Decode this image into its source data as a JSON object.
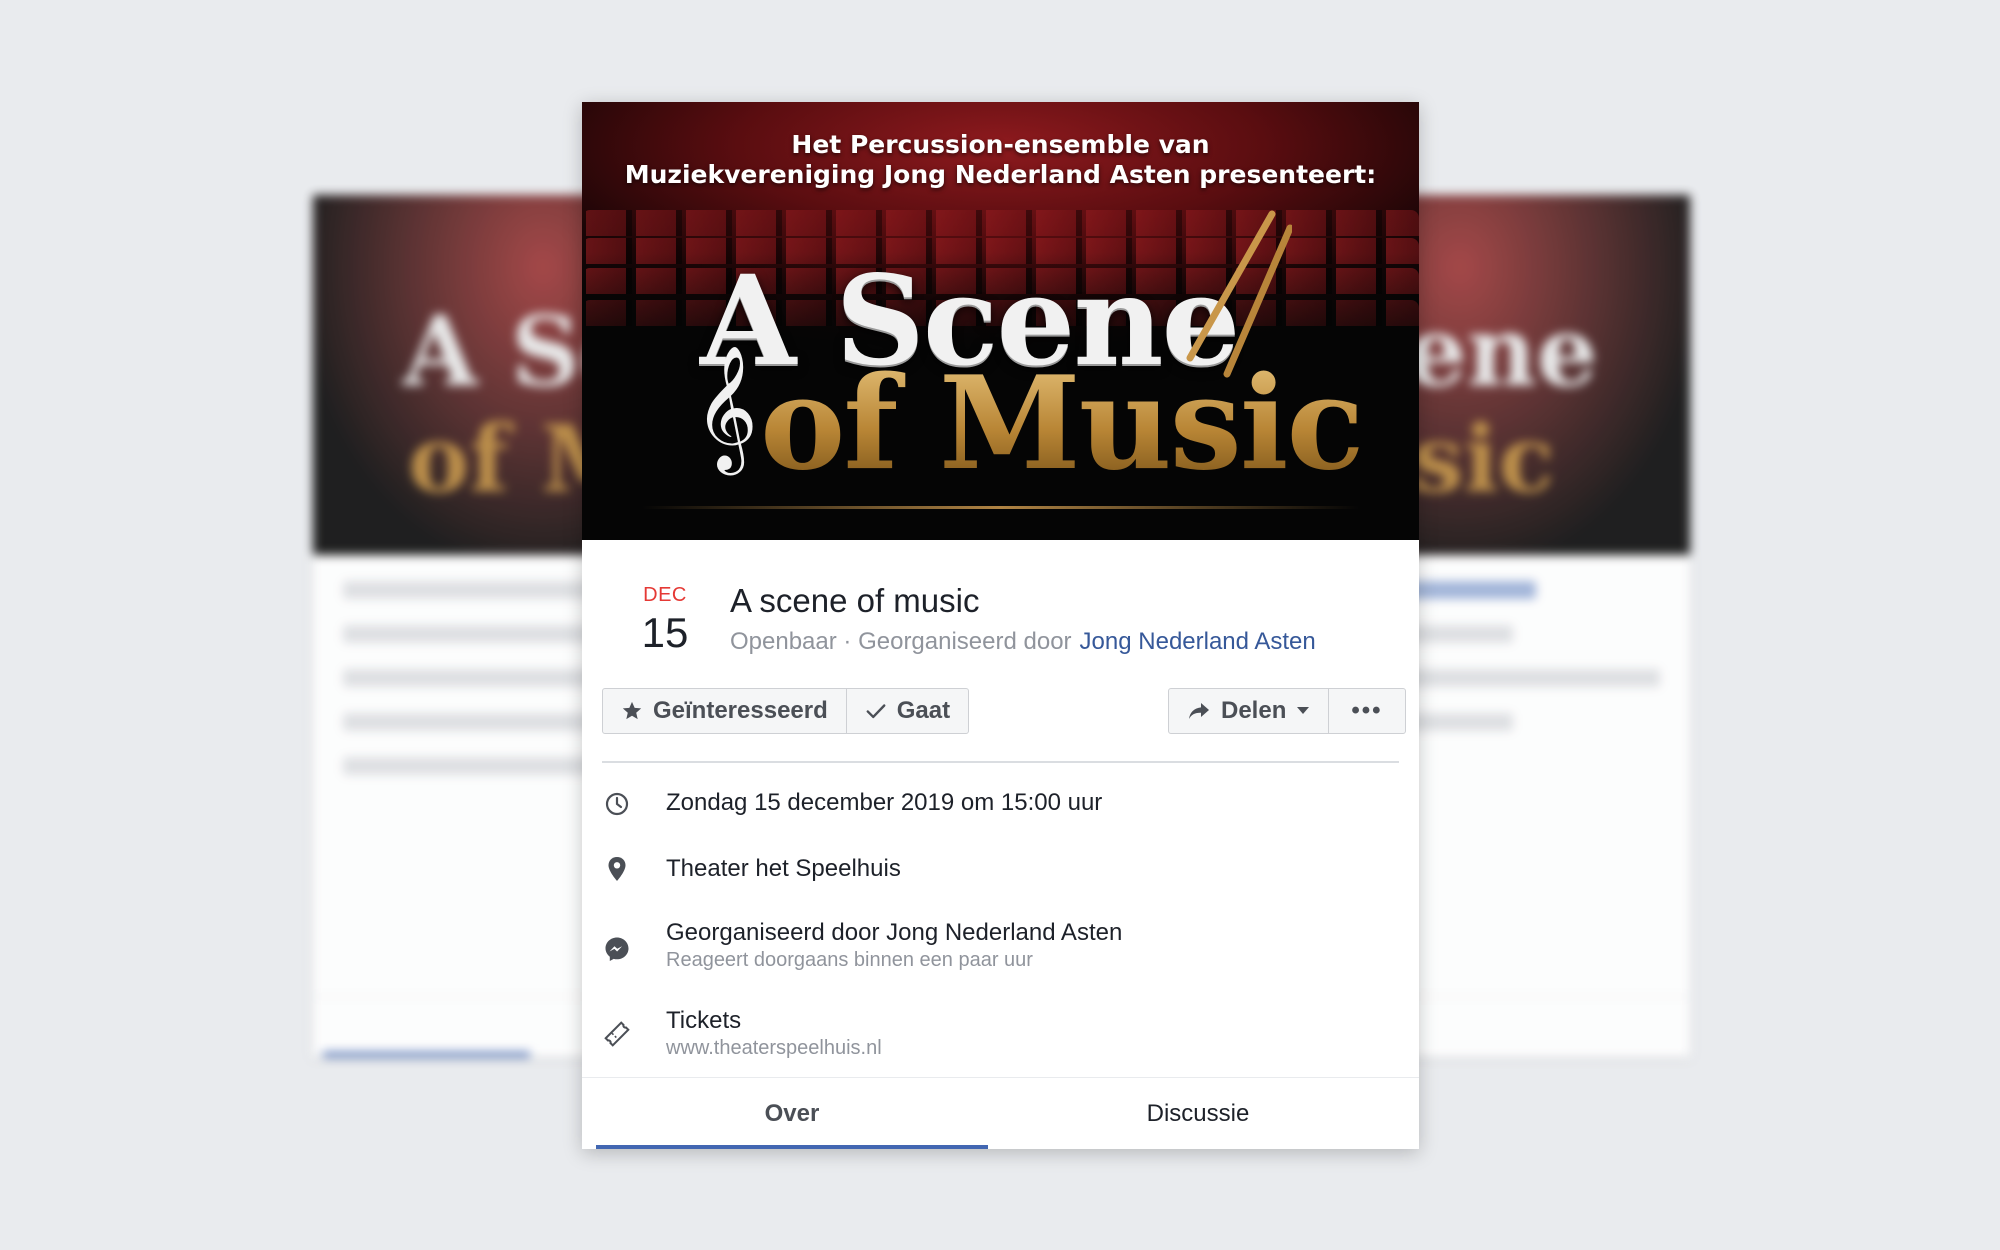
{
  "banner": {
    "subtitle_line1": "Het Percussion-ensemble van",
    "subtitle_line2": "Muziekvereniging Jong Nederland Asten presenteert:",
    "title_line1": "A Scene",
    "title_line2": "of Music",
    "clef_glyph": "𝄞"
  },
  "event": {
    "month": "DEC",
    "day": "15",
    "title": "A scene of music",
    "visibility": "Openbaar · Georganiseerd door",
    "organizer": "Jong Nederland Asten"
  },
  "actions": {
    "interested_label": "Geïnteresseerd",
    "going_label": "Gaat",
    "share_label": "Delen",
    "more_label": "•••"
  },
  "details": {
    "datetime": "Zondag 15 december 2019 om 15:00 uur",
    "location": "Theater het Speelhuis",
    "organizer_line": "Georganiseerd door Jong Nederland Asten",
    "response_time": "Reageert doorgaans binnen een paar uur",
    "tickets_label": "Tickets",
    "tickets_url": "www.theaterspeelhuis.nl"
  },
  "tabs": {
    "about": "Over",
    "discussion": "Discussie"
  },
  "icons": {
    "interested": "star-icon",
    "going": "checkmark-icon",
    "share": "share-arrow-icon",
    "share_caret": "caret-down-icon",
    "time": "clock-icon",
    "location": "map-pin-icon",
    "messenger": "messenger-icon",
    "tickets": "ticket-icon"
  },
  "colors": {
    "accent_blue": "#4267b2",
    "link_blue": "#365899",
    "month_red": "#e53935",
    "gold": "#c79a4c"
  }
}
